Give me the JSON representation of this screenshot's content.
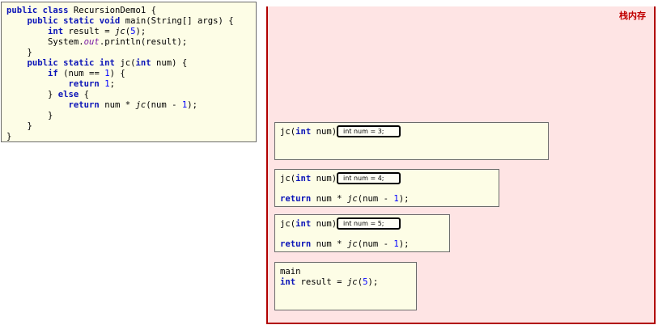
{
  "code": {
    "lines": [
      [
        {
          "t": "public class ",
          "c": "kw"
        },
        {
          "t": "RecursionDemo1 {",
          "c": ""
        }
      ],
      [
        {
          "t": "    public static void ",
          "c": "kw"
        },
        {
          "t": "main(String[] args) {",
          "c": ""
        }
      ],
      [
        {
          "t": "        ",
          "c": ""
        },
        {
          "t": "int ",
          "c": "kw"
        },
        {
          "t": "result = ",
          "c": ""
        },
        {
          "t": "jc",
          "c": "it"
        },
        {
          "t": "(",
          "c": ""
        },
        {
          "t": "5",
          "c": "num"
        },
        {
          "t": ");",
          "c": ""
        }
      ],
      [
        {
          "t": "        System.",
          "c": ""
        },
        {
          "t": "out",
          "c": "fld"
        },
        {
          "t": ".println(result);",
          "c": ""
        }
      ],
      [
        {
          "t": "    }",
          "c": ""
        }
      ],
      [
        {
          "t": "    public static int ",
          "c": "kw"
        },
        {
          "t": "jc(",
          "c": ""
        },
        {
          "t": "int ",
          "c": "kw"
        },
        {
          "t": "num) {",
          "c": ""
        }
      ],
      [
        {
          "t": "        ",
          "c": ""
        },
        {
          "t": "if ",
          "c": "kw"
        },
        {
          "t": "(num == ",
          "c": ""
        },
        {
          "t": "1",
          "c": "num"
        },
        {
          "t": ") {",
          "c": ""
        }
      ],
      [
        {
          "t": "            ",
          "c": ""
        },
        {
          "t": "return ",
          "c": "kw"
        },
        {
          "t": "1",
          "c": "num"
        },
        {
          "t": ";",
          "c": ""
        }
      ],
      [
        {
          "t": "        } ",
          "c": ""
        },
        {
          "t": "else ",
          "c": "kw"
        },
        {
          "t": "{",
          "c": ""
        }
      ],
      [
        {
          "t": "            ",
          "c": ""
        },
        {
          "t": "return ",
          "c": "kw"
        },
        {
          "t": "num * ",
          "c": ""
        },
        {
          "t": "jc",
          "c": "it"
        },
        {
          "t": "(num - ",
          "c": ""
        },
        {
          "t": "1",
          "c": "num"
        },
        {
          "t": ");",
          "c": ""
        }
      ],
      [
        {
          "t": "        }",
          "c": ""
        }
      ],
      [
        {
          "t": "    }",
          "c": ""
        }
      ],
      [
        {
          "t": "}",
          "c": ""
        }
      ]
    ]
  },
  "stack": {
    "title": "栈内存",
    "frames": [
      {
        "sig": [
          {
            "t": "jc(",
            "c": ""
          },
          {
            "t": "int ",
            "c": "kw"
          },
          {
            "t": "num)",
            "c": ""
          }
        ],
        "var": "int num = 3;",
        "ret": []
      },
      {
        "sig": [
          {
            "t": "jc(",
            "c": ""
          },
          {
            "t": "int ",
            "c": "kw"
          },
          {
            "t": "num)",
            "c": ""
          }
        ],
        "var": "int num = 4;",
        "ret": [
          {
            "t": "return ",
            "c": "kw"
          },
          {
            "t": "num * ",
            "c": ""
          },
          {
            "t": "jc",
            "c": "it"
          },
          {
            "t": "(num - ",
            "c": ""
          },
          {
            "t": "1",
            "c": "num"
          },
          {
            "t": ");",
            "c": ""
          }
        ]
      },
      {
        "sig": [
          {
            "t": "jc(",
            "c": ""
          },
          {
            "t": "int ",
            "c": "kw"
          },
          {
            "t": "num)",
            "c": ""
          }
        ],
        "var": "int num = 5;",
        "ret": [
          {
            "t": "return ",
            "c": "kw"
          },
          {
            "t": "num * ",
            "c": ""
          },
          {
            "t": "jc",
            "c": "it"
          },
          {
            "t": "(num - ",
            "c": ""
          },
          {
            "t": "1",
            "c": "num"
          },
          {
            "t": ");",
            "c": ""
          }
        ]
      }
    ],
    "main": {
      "l1": [
        {
          "t": "main",
          "c": ""
        }
      ],
      "l2": [
        {
          "t": "int ",
          "c": "kw"
        },
        {
          "t": "result = ",
          "c": ""
        },
        {
          "t": "jc",
          "c": "it"
        },
        {
          "t": "(",
          "c": ""
        },
        {
          "t": "5",
          "c": "num"
        },
        {
          "t": ");",
          "c": ""
        }
      ]
    }
  }
}
